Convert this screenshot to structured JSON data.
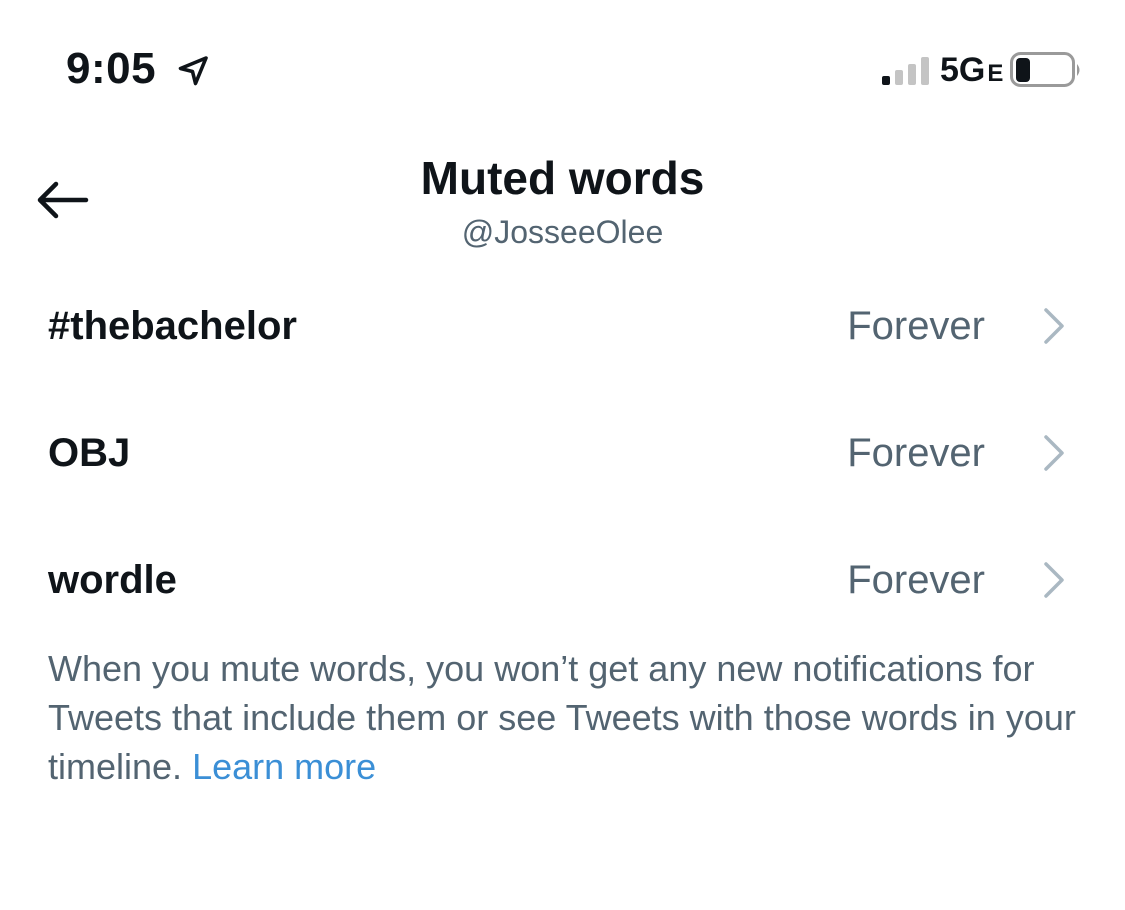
{
  "status_bar": {
    "time": "9:05",
    "network": "5G",
    "network_suffix": "E"
  },
  "header": {
    "title": "Muted words",
    "subtitle": "@JosseeOlee"
  },
  "muted_words": [
    {
      "word": "#thebachelor",
      "duration": "Forever"
    },
    {
      "word": "OBJ",
      "duration": "Forever"
    },
    {
      "word": "wordle",
      "duration": "Forever"
    }
  ],
  "note": {
    "text": "When you mute words, you won’t get any new notifications for Tweets that include them or see Tweets with those words in your timeline.",
    "link": "Learn more"
  },
  "colors": {
    "text_primary": "#0f1419",
    "text_secondary": "#536471",
    "link": "#3b8fd6",
    "chevron": "#aab8c2"
  },
  "icons": {
    "back": "arrow-left-icon",
    "location": "location-arrow-icon",
    "signal": "cellular-signal-icon",
    "battery": "battery-icon",
    "row_chevron": "chevron-right-icon"
  }
}
